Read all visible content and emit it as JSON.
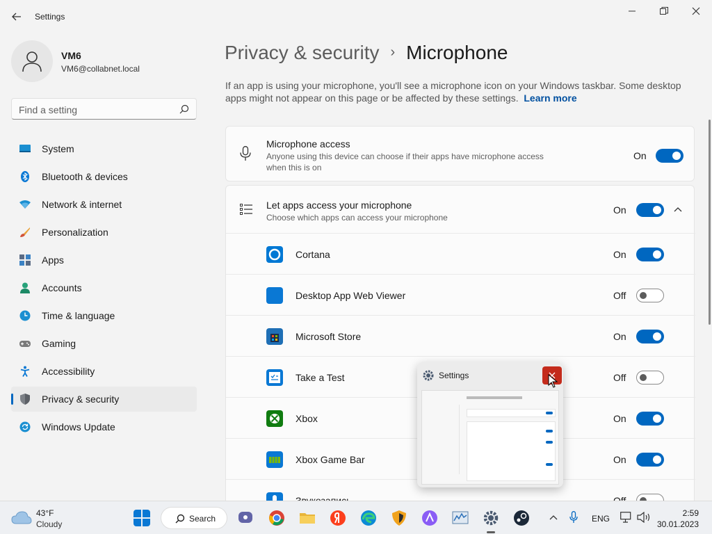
{
  "window": {
    "title": "Settings"
  },
  "user": {
    "name": "VM6",
    "email": "VM6@collabnet.local"
  },
  "search": {
    "placeholder": "Find a setting"
  },
  "sidebar": {
    "items": [
      {
        "label": "System",
        "icon": "system-icon"
      },
      {
        "label": "Bluetooth & devices",
        "icon": "bluetooth-icon"
      },
      {
        "label": "Network & internet",
        "icon": "network-icon"
      },
      {
        "label": "Personalization",
        "icon": "brush-icon"
      },
      {
        "label": "Apps",
        "icon": "apps-icon"
      },
      {
        "label": "Accounts",
        "icon": "accounts-icon"
      },
      {
        "label": "Time & language",
        "icon": "clock-icon"
      },
      {
        "label": "Gaming",
        "icon": "gamepad-icon"
      },
      {
        "label": "Accessibility",
        "icon": "accessibility-icon"
      },
      {
        "label": "Privacy & security",
        "icon": "shield-icon",
        "selected": true
      },
      {
        "label": "Windows Update",
        "icon": "update-icon"
      }
    ]
  },
  "breadcrumb": {
    "parent": "Privacy & security",
    "separator": "›",
    "current": "Microphone"
  },
  "description": {
    "text": "If an app is using your microphone, you'll see a microphone icon on your Windows taskbar. Some desktop apps might not appear on this page or be affected by these settings.",
    "link": "Learn more"
  },
  "mic_access": {
    "title": "Microphone access",
    "subtitle_line1": "Anyone using this device can choose if their apps have microphone access",
    "subtitle_line2": "when this is on",
    "state": "On"
  },
  "let_apps": {
    "title": "Let apps access your microphone",
    "subtitle": "Choose which apps can access your microphone",
    "state": "On"
  },
  "apps": [
    {
      "name": "Cortana",
      "state": "On"
    },
    {
      "name": "Desktop App Web Viewer",
      "state": "Off"
    },
    {
      "name": "Microsoft Store",
      "state": "On"
    },
    {
      "name": "Take a Test",
      "state": "Off"
    },
    {
      "name": "Xbox",
      "state": "On"
    },
    {
      "name": "Xbox Game Bar",
      "state": "On"
    },
    {
      "name": "Звукозапись",
      "state": "Off"
    }
  ],
  "thumbnail": {
    "title": "Settings"
  },
  "taskbar": {
    "weather_temp": "43°F",
    "weather_cond": "Cloudy",
    "search_label": "Search",
    "language": "ENG",
    "time": "2:59",
    "date": "30.01.2023"
  },
  "colors": {
    "accent": "#0067c0",
    "close_red": "#c42b1c"
  }
}
